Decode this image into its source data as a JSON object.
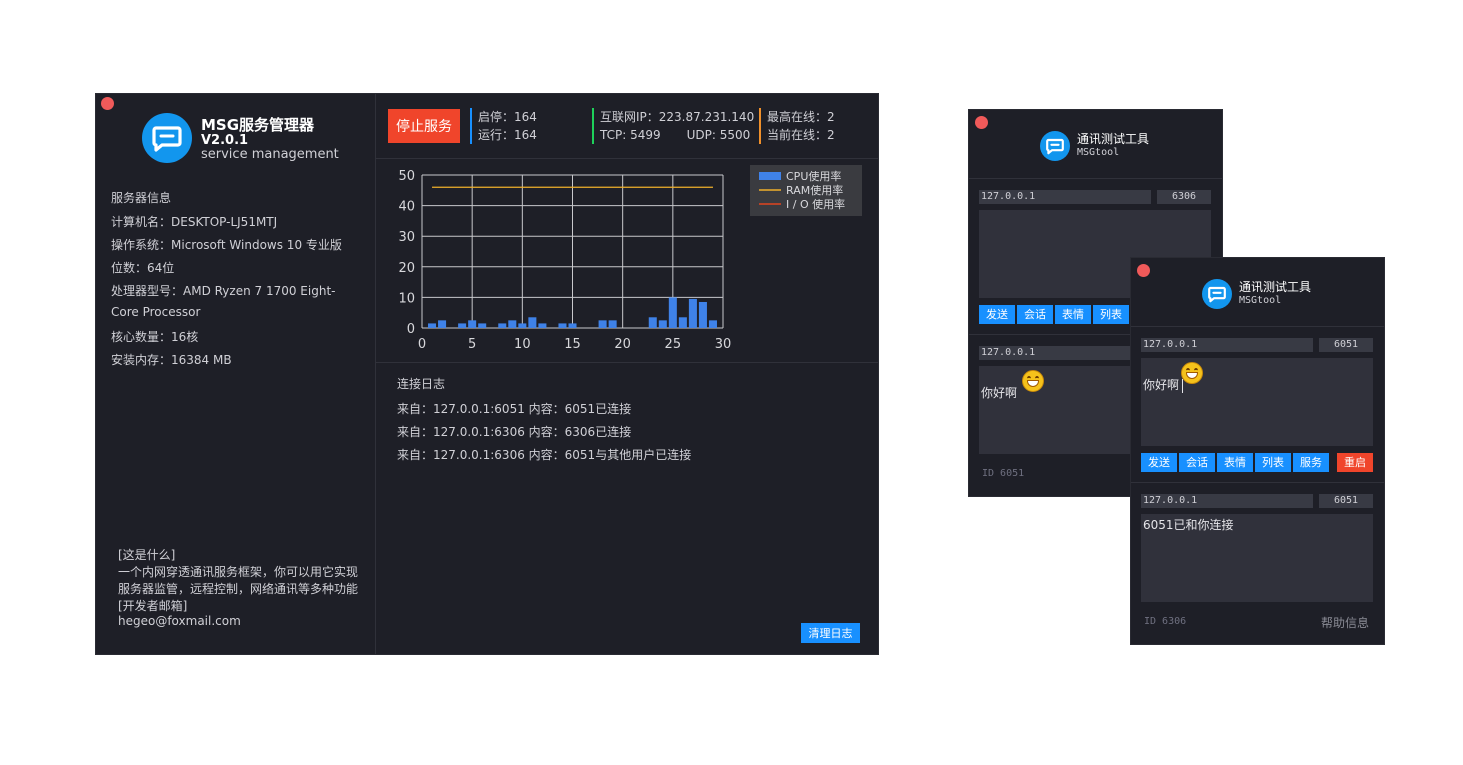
{
  "main": {
    "app_title": "MSG服务管理器",
    "app_version": "V2.0.1",
    "app_subtitle": "service management",
    "server_info": {
      "heading": "服务器信息",
      "computer_name": "计算机名：DESKTOP-LJ51MTJ",
      "os": "操作系统：Microsoft Windows 10 专业版",
      "bits": "位数：64位",
      "cpu_line1": "处理器型号：AMD Ryzen 7 1700 Eight-",
      "cpu_line2": "Core Processor",
      "cores": "核心数量：16核",
      "memory": "安装内存：16384 MB"
    },
    "about": {
      "heading": "[这是什么]",
      "line1": "一个内网穿透通讯服务框架，你可以用它实现",
      "line2": "服务器监管，远程控制，网络通讯等多种功能",
      "dev_heading": "[开发者邮箱]",
      "email": "hegeo@foxmail.com"
    },
    "stop_button": "停止服务",
    "stats": {
      "starts": "启停：164",
      "running": "运行：164",
      "ip": "互联网IP：223.87.231.140",
      "tcp": "TCP: 5499",
      "udp": "UDP: 5500",
      "max_online": "最高在线：2",
      "cur_online": "当前在线：2"
    },
    "colors": {
      "cpu": "#3f82e8",
      "ram": "#f0b02b",
      "io": "#e0441f",
      "accent": "#1890ff",
      "danger": "#f0452b"
    },
    "log": {
      "title": "连接日志",
      "entries": [
        "来自：127.0.0.1:6051 内容：6051已连接",
        "来自：127.0.0.1:6306 内容：6306已连接",
        "来自：127.0.0.1:6306 内容：6051与其他用户已连接"
      ],
      "clear_button": "清理日志"
    }
  },
  "chart_data": {
    "type": "bar",
    "xlim": [
      0,
      30
    ],
    "ylim": [
      0,
      50
    ],
    "xticks": [
      0,
      5,
      10,
      15,
      20,
      25,
      30
    ],
    "yticks": [
      0,
      10,
      20,
      30,
      40,
      50
    ],
    "grid": true,
    "legend_position": "top-right",
    "legend": [
      "CPU使用率",
      "RAM使用率",
      "I / O 使用率"
    ],
    "series": [
      {
        "name": "CPU使用率",
        "type": "bar",
        "x": [
          1,
          2,
          4,
          5,
          6,
          8,
          9,
          10,
          11,
          12,
          14,
          15,
          18,
          19,
          23,
          24,
          25,
          26,
          27,
          28,
          29
        ],
        "values": [
          1.5,
          2.5,
          1.5,
          2.5,
          1.5,
          1.5,
          2.5,
          1.5,
          3.5,
          1.5,
          1.5,
          1.5,
          2.5,
          2.5,
          3.5,
          2.5,
          10,
          3.5,
          9.5,
          8.5,
          2.5
        ]
      },
      {
        "name": "RAM使用率",
        "type": "line",
        "x": [
          1,
          29
        ],
        "values": [
          46,
          46
        ]
      },
      {
        "name": "I / O 使用率",
        "type": "line",
        "x": [],
        "values": []
      }
    ]
  },
  "tool1": {
    "title": "通讯测试工具",
    "subtitle": "MSGtool",
    "ip1": "127.0.0.1",
    "port1": "6306",
    "ip2": "127.0.0.1",
    "buttons": [
      "发送",
      "会话",
      "表情",
      "列表"
    ],
    "message": "你好啊",
    "id": "ID 6051"
  },
  "tool2": {
    "title": "通讯测试工具",
    "subtitle": "MSGtool",
    "ip1": "127.0.0.1",
    "port1": "6051",
    "message": "你好啊",
    "buttons": [
      "发送",
      "会话",
      "表情",
      "列表",
      "服务"
    ],
    "restart": "重启",
    "ip2": "127.0.0.1",
    "port2": "6051",
    "received": "6051已和你连接",
    "id": "ID 6306",
    "help": "帮助信息"
  }
}
